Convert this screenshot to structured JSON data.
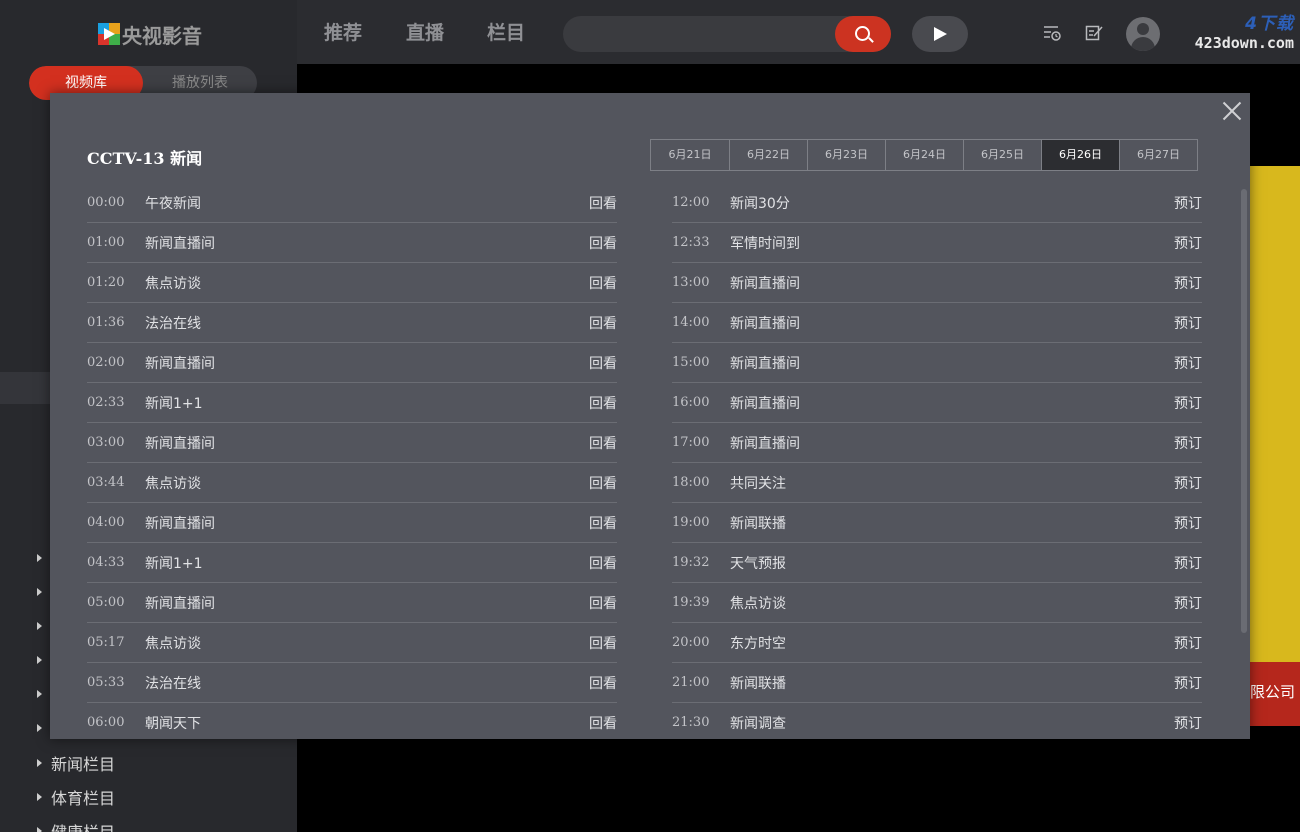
{
  "app": {
    "logo_text": "央视影音",
    "logo_icon": "cntv-logo-icon"
  },
  "sidebar": {
    "tabs": [
      {
        "label": "视频库",
        "active": true
      },
      {
        "label": "播放列表",
        "active": false
      }
    ],
    "menu": [
      {
        "label": "新闻栏目"
      },
      {
        "label": "体育栏目"
      },
      {
        "label": "健康栏目"
      }
    ]
  },
  "nav": {
    "items": [
      {
        "label": "推荐"
      },
      {
        "label": "直播"
      },
      {
        "label": "栏目"
      }
    ]
  },
  "search": {
    "placeholder": "",
    "icon": "search-icon"
  },
  "toolbar": {
    "icons": [
      "history-icon",
      "edit-icon",
      "avatar-icon"
    ]
  },
  "watermark": {
    "top": "4下载",
    "url": "423down.com"
  },
  "background": {
    "partial_text": "限公司"
  },
  "modal": {
    "title": "CCTV-13  新闻",
    "dates": [
      {
        "label": "6月21日",
        "active": false
      },
      {
        "label": "6月22日",
        "active": false
      },
      {
        "label": "6月23日",
        "active": false
      },
      {
        "label": "6月24日",
        "active": false
      },
      {
        "label": "6月25日",
        "active": false
      },
      {
        "label": "6月26日",
        "active": true
      },
      {
        "label": "6月27日",
        "active": false
      }
    ],
    "left": [
      {
        "time": "00:00",
        "name": "午夜新闻",
        "action": "回看"
      },
      {
        "time": "01:00",
        "name": "新闻直播间",
        "action": "回看"
      },
      {
        "time": "01:20",
        "name": "焦点访谈",
        "action": "回看"
      },
      {
        "time": "01:36",
        "name": "法治在线",
        "action": "回看"
      },
      {
        "time": "02:00",
        "name": "新闻直播间",
        "action": "回看"
      },
      {
        "time": "02:33",
        "name": "新闻1+1",
        "action": "回看"
      },
      {
        "time": "03:00",
        "name": "新闻直播间",
        "action": "回看"
      },
      {
        "time": "03:44",
        "name": "焦点访谈",
        "action": "回看"
      },
      {
        "time": "04:00",
        "name": "新闻直播间",
        "action": "回看"
      },
      {
        "time": "04:33",
        "name": "新闻1+1",
        "action": "回看"
      },
      {
        "time": "05:00",
        "name": "新闻直播间",
        "action": "回看"
      },
      {
        "time": "05:17",
        "name": "焦点访谈",
        "action": "回看"
      },
      {
        "time": "05:33",
        "name": "法治在线",
        "action": "回看"
      },
      {
        "time": "06:00",
        "name": "朝闻天下",
        "action": "回看"
      }
    ],
    "right": [
      {
        "time": "12:00",
        "name": "新闻30分",
        "action": "预订"
      },
      {
        "time": "12:33",
        "name": "军情时间到",
        "action": "预订"
      },
      {
        "time": "13:00",
        "name": "新闻直播间",
        "action": "预订"
      },
      {
        "time": "14:00",
        "name": "新闻直播间",
        "action": "预订"
      },
      {
        "time": "15:00",
        "name": "新闻直播间",
        "action": "预订"
      },
      {
        "time": "16:00",
        "name": "新闻直播间",
        "action": "预订"
      },
      {
        "time": "17:00",
        "name": "新闻直播间",
        "action": "预订"
      },
      {
        "time": "18:00",
        "name": "共同关注",
        "action": "预订"
      },
      {
        "time": "19:00",
        "name": "新闻联播",
        "action": "预订"
      },
      {
        "time": "19:32",
        "name": "天气预报",
        "action": "预订"
      },
      {
        "time": "19:39",
        "name": "焦点访谈",
        "action": "预订"
      },
      {
        "time": "20:00",
        "name": "东方时空",
        "action": "预订"
      },
      {
        "time": "21:00",
        "name": "新闻联播",
        "action": "预订"
      },
      {
        "time": "21:30",
        "name": "新闻调查",
        "action": "预订"
      }
    ]
  },
  "colors": {
    "accent": "#d3301f",
    "modal_bg": "#53555d",
    "sidebar_bg": "#28292d",
    "topbar_bg": "#2b2c30"
  }
}
